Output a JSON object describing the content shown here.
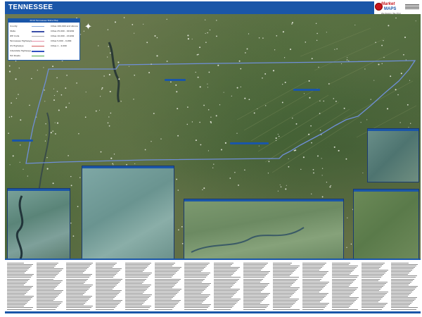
{
  "map_title": "TENNESSEE",
  "brand": {
    "name": "Market",
    "name2": "MAPS",
    "tagline": "We Design, We Print"
  },
  "legend": {
    "header": "2019 Tennessee State Map",
    "items": [
      {
        "label": "County",
        "color": "#8aa9d8"
      },
      {
        "label": "State",
        "color": "#3a4fa8"
      },
      {
        "label": "ZIP Code",
        "color": "#b0b0b0"
      },
      {
        "label": "Tennessee Highways",
        "color": "#e58fa8"
      },
      {
        "label": "US Highways",
        "color": "#d45a5a"
      },
      {
        "label": "Interstate Highways",
        "color": "#3050c0"
      },
      {
        "label": "Toll Roads",
        "color": "#4aa845"
      }
    ],
    "city_classes": [
      "Cities 100,000 and Above",
      "Cities 25,000 - 99,999",
      "Cities 10,000 - 24,999",
      "Cities 5,000 - 9,999",
      "Cities 1 - 4,999"
    ]
  },
  "colors": {
    "brand_blue": "#1a56a8",
    "state_border": "#6f8fd8",
    "brand_red": "#c7161d"
  },
  "icons": [
    "compass-rose-icon",
    "brand-logo-icon"
  ]
}
